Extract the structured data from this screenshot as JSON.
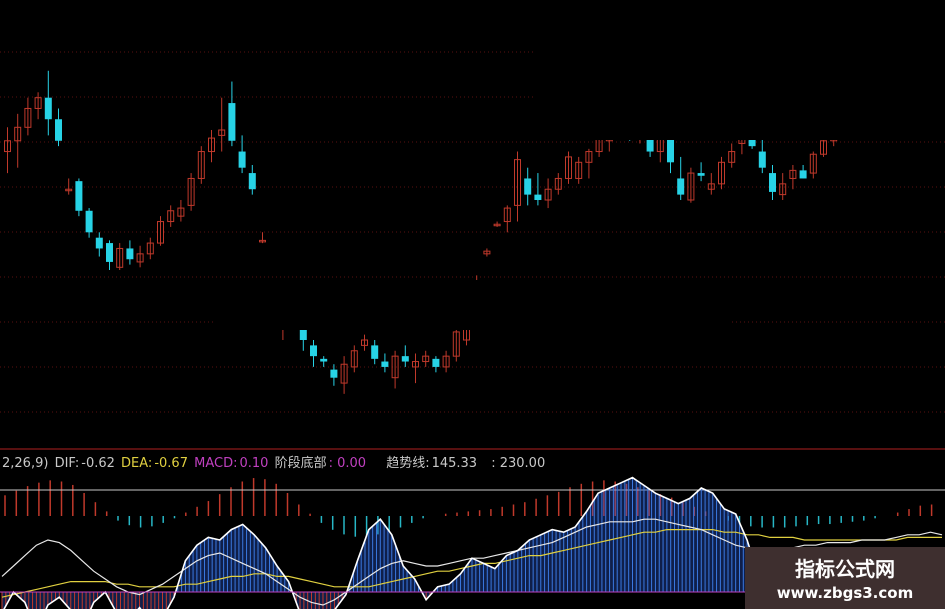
{
  "legend": {
    "params": "2,26,9)",
    "dif_label": "DIF:",
    "dif_value": "-0.62",
    "dea_label": "DEA:",
    "dea_value": "-0.67",
    "macd_label": "MACD:",
    "macd_value": "0.10",
    "stage_bottom_label": "阶段底部",
    "stage_bottom_value": ": 0.00",
    "trend_label": "趋势线:",
    "trend_value": "145.33",
    "level_value": ": 230.00"
  },
  "watermark": {
    "line1": "指标公式网",
    "line2": "www.zbgs3.com"
  },
  "colors": {
    "background": "#000000",
    "up": "#c0392b",
    "down": "#27d3e6",
    "grid": "#5a0f0f",
    "dif": "#e8e8e8",
    "dea": "#e0d040",
    "trend_line": "#ffffff",
    "trend_fill": "#2a5ad4",
    "panel_border": "#b02020",
    "macd_pos": "#c0392b",
    "macd_neg": "#27b7c6",
    "stage_highlight": "#2fbf2f"
  },
  "chart_data": [
    {
      "type": "candlestick",
      "candles": [
        [
          100.6,
          101.5,
          99.8,
          101.0
        ],
        [
          101.0,
          102.0,
          100.0,
          101.5
        ],
        [
          101.5,
          102.6,
          101.2,
          102.2
        ],
        [
          102.2,
          102.8,
          101.8,
          102.6
        ],
        [
          102.6,
          103.6,
          101.2,
          101.8
        ],
        [
          101.8,
          102.2,
          100.8,
          101.0
        ],
        [
          99.2,
          99.6,
          99.0,
          99.2
        ],
        [
          99.5,
          99.6,
          98.2,
          98.4
        ],
        [
          98.4,
          98.5,
          97.4,
          97.6
        ],
        [
          97.4,
          97.6,
          96.7,
          97.0
        ],
        [
          97.2,
          97.3,
          96.2,
          96.5
        ],
        [
          96.3,
          97.2,
          96.2,
          97.0
        ],
        [
          97.0,
          97.3,
          96.4,
          96.6
        ],
        [
          96.5,
          97.1,
          96.3,
          96.8
        ],
        [
          96.8,
          97.4,
          96.6,
          97.2
        ],
        [
          97.2,
          98.2,
          97.1,
          98.0
        ],
        [
          98.0,
          98.6,
          97.8,
          98.4
        ],
        [
          98.2,
          98.8,
          98.0,
          98.5
        ],
        [
          98.6,
          99.8,
          98.4,
          99.6
        ],
        [
          99.6,
          100.8,
          99.4,
          100.6
        ],
        [
          100.6,
          101.4,
          100.2,
          101.1
        ],
        [
          101.2,
          102.6,
          100.6,
          101.4
        ],
        [
          102.4,
          103.2,
          100.8,
          101.0
        ],
        [
          100.6,
          101.2,
          99.8,
          100.0
        ],
        [
          99.8,
          100.1,
          99.0,
          99.2
        ],
        [
          97.3,
          97.6,
          97.2,
          97.3
        ],
        [
          94.4,
          94.8,
          94.2,
          94.4
        ],
        [
          94.0,
          94.3,
          93.6,
          94.2
        ],
        [
          94.6,
          95.0,
          94.4,
          94.7
        ],
        [
          94.2,
          94.4,
          93.2,
          93.6
        ],
        [
          93.4,
          93.6,
          92.6,
          93.0
        ],
        [
          92.9,
          93.0,
          92.6,
          92.8
        ],
        [
          92.5,
          92.7,
          91.9,
          92.2
        ],
        [
          92.0,
          93.0,
          91.6,
          92.7
        ],
        [
          92.6,
          93.4,
          92.4,
          93.2
        ],
        [
          93.4,
          93.8,
          93.2,
          93.6
        ],
        [
          93.4,
          93.6,
          92.7,
          92.9
        ],
        [
          92.8,
          93.1,
          92.4,
          92.6
        ],
        [
          92.2,
          93.2,
          91.8,
          93.0
        ],
        [
          93.0,
          93.4,
          92.6,
          92.8
        ],
        [
          92.6,
          93.1,
          92.0,
          92.8
        ],
        [
          92.8,
          93.2,
          92.6,
          93.0
        ],
        [
          92.9,
          93.0,
          92.4,
          92.6
        ],
        [
          92.6,
          93.2,
          92.4,
          93.0
        ],
        [
          93.0,
          94.0,
          92.8,
          93.9
        ],
        [
          93.6,
          94.5,
          93.4,
          94.2
        ],
        [
          94.2,
          96.0,
          94.1,
          95.8
        ],
        [
          96.8,
          97.0,
          96.7,
          96.9
        ],
        [
          97.9,
          98.0,
          97.8,
          97.9
        ],
        [
          98.0,
          98.6,
          97.6,
          98.5
        ],
        [
          98.6,
          100.6,
          98.0,
          100.3
        ],
        [
          99.6,
          100.0,
          98.6,
          99.0
        ],
        [
          99.0,
          99.8,
          98.6,
          98.8
        ],
        [
          98.8,
          99.6,
          98.5,
          99.2
        ],
        [
          99.2,
          99.8,
          99.0,
          99.6
        ],
        [
          99.6,
          100.6,
          99.4,
          100.4
        ],
        [
          99.6,
          100.4,
          99.4,
          100.2
        ],
        [
          100.2,
          100.7,
          99.6,
          100.6
        ],
        [
          100.6,
          101.4,
          100.4,
          101.2
        ],
        [
          101.0,
          101.6,
          100.6,
          101.6
        ],
        [
          101.6,
          102.2,
          101.4,
          101.6
        ],
        [
          101.6,
          101.8,
          101.0,
          101.3
        ],
        [
          101.3,
          101.8,
          100.9,
          101.6
        ],
        [
          101.6,
          101.8,
          100.4,
          100.6
        ],
        [
          100.6,
          101.7,
          100.2,
          101.6
        ],
        [
          101.7,
          101.8,
          99.8,
          100.2
        ],
        [
          99.6,
          100.4,
          98.8,
          99.0
        ],
        [
          98.8,
          100.0,
          98.7,
          99.8
        ],
        [
          99.8,
          100.2,
          99.5,
          99.7
        ],
        [
          99.2,
          99.8,
          99.0,
          99.4
        ],
        [
          99.4,
          100.4,
          99.2,
          100.2
        ],
        [
          100.2,
          100.9,
          100.0,
          100.6
        ],
        [
          100.9,
          101.3,
          100.5,
          101.4
        ],
        [
          101.2,
          101.3,
          100.7,
          100.8
        ],
        [
          100.6,
          101.2,
          99.8,
          100.0
        ],
        [
          99.8,
          100.1,
          98.8,
          99.1
        ],
        [
          99.0,
          99.8,
          98.8,
          99.4
        ],
        [
          99.6,
          100.1,
          99.2,
          99.9
        ],
        [
          99.9,
          100.1,
          99.6,
          99.6
        ],
        [
          99.8,
          100.6,
          99.6,
          100.5
        ],
        [
          100.5,
          101.2,
          100.4,
          101.0
        ],
        [
          101.0,
          102.0,
          100.8,
          101.8
        ],
        [
          101.9,
          102.2,
          101.7,
          102.0
        ]
      ]
    },
    {
      "type": "bar",
      "series": [
        {
          "name": "MACD",
          "values": [
            0.18,
            0.22,
            0.26,
            0.29,
            0.31,
            0.3,
            0.27,
            0.2,
            0.12,
            0.04,
            -0.04,
            -0.08,
            -0.1,
            -0.09,
            -0.06,
            -0.02,
            0.03,
            0.08,
            0.13,
            0.19,
            0.25,
            0.3,
            0.33,
            0.32,
            0.28,
            0.2,
            0.1,
            0.02,
            -0.06,
            -0.12,
            -0.16,
            -0.18,
            -0.18,
            -0.16,
            -0.13,
            -0.1,
            -0.06,
            -0.02,
            0.0,
            0.02,
            0.03,
            0.04,
            0.05,
            0.06,
            0.08,
            0.1,
            0.12,
            0.15,
            0.18,
            0.21,
            0.25,
            0.28,
            0.3,
            0.31,
            0.3,
            0.28,
            0.25,
            0.22,
            0.19,
            0.16,
            0.12,
            0.08,
            0.04,
            0.0,
            -0.04,
            -0.07,
            -0.09,
            -0.1,
            -0.1,
            -0.1,
            -0.09,
            -0.08,
            -0.07,
            -0.07,
            -0.06,
            -0.05,
            -0.04,
            -0.02,
            0.0,
            0.03,
            0.06,
            0.09,
            0.1
          ]
        }
      ]
    },
    {
      "type": "line",
      "series": [
        {
          "name": "DIF",
          "values": [
            6,
            10,
            14,
            18,
            20,
            19,
            16,
            12,
            8,
            5,
            2,
            0,
            -1,
            1,
            3,
            6,
            9,
            12,
            14,
            15,
            13,
            11,
            9,
            7,
            4,
            1,
            -2,
            -4,
            -5,
            -3,
            0,
            3,
            6,
            9,
            11,
            12,
            11,
            10,
            10,
            11,
            12,
            13,
            13,
            14,
            15,
            16,
            17,
            18,
            19,
            21,
            23,
            25,
            26,
            27,
            27,
            27,
            28,
            28,
            27,
            26,
            25,
            24,
            22,
            20,
            18,
            17,
            16,
            16,
            16,
            17,
            18,
            18,
            19,
            19,
            19,
            20,
            20,
            20,
            21,
            22,
            22,
            23,
            22
          ]
        },
        {
          "name": "DEA",
          "values": [
            -2,
            -1,
            0,
            1,
            2,
            3,
            4,
            4,
            4,
            4,
            3,
            3,
            2,
            2,
            2,
            2,
            3,
            3,
            4,
            5,
            6,
            6,
            7,
            7,
            6,
            6,
            5,
            4,
            3,
            2,
            2,
            2,
            2,
            3,
            4,
            5,
            6,
            7,
            8,
            8,
            9,
            10,
            11,
            11,
            12,
            13,
            14,
            14,
            15,
            16,
            17,
            18,
            19,
            20,
            21,
            22,
            23,
            23,
            24,
            24,
            24,
            24,
            24,
            23,
            23,
            22,
            22,
            21,
            21,
            21,
            20,
            20,
            20,
            20,
            20,
            20,
            20,
            20,
            20,
            21,
            21,
            21,
            21
          ]
        },
        {
          "name": "趋势线",
          "values": [
            -8,
            0,
            -4,
            -15,
            -5,
            -2,
            -7,
            -14,
            -4,
            0,
            -8,
            -11,
            -6,
            -12,
            -10,
            -2,
            12,
            18,
            21,
            20,
            24,
            26,
            22,
            17,
            10,
            4,
            -8,
            -14,
            -12,
            -7,
            -1,
            12,
            24,
            28,
            22,
            10,
            5,
            -3,
            2,
            3,
            7,
            13,
            11,
            9,
            14,
            16,
            20,
            22,
            24,
            23,
            25,
            31,
            38,
            40,
            42,
            44,
            41,
            38,
            36,
            34,
            36,
            40,
            38,
            32,
            30,
            20,
            6,
            -12,
            -8,
            -4,
            -12,
            -13,
            2,
            0,
            5,
            8,
            12,
            15,
            11,
            13,
            16,
            9,
            5
          ]
        }
      ]
    }
  ]
}
